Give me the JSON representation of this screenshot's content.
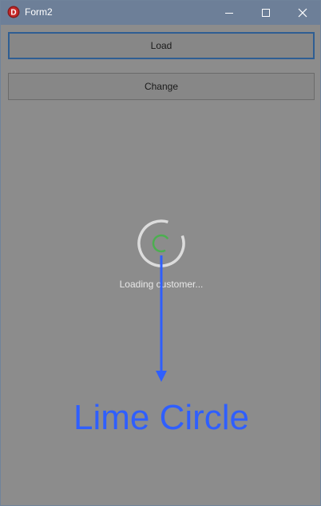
{
  "window": {
    "title": "Form2",
    "app_icon_letter": "D"
  },
  "buttons": {
    "load_label": "Load",
    "change_label": "Change"
  },
  "loading": {
    "text": "Loading customer..."
  },
  "annotation": {
    "text": "Lime Circle"
  },
  "colors": {
    "titlebar": "#6d7f98",
    "form_background": "#8c8c8c",
    "spinner_ring": "#e0e0e0",
    "spinner_inner": "#4caf50",
    "annotation_blue": "#2f5fff",
    "focus_border": "#2f5e93"
  },
  "icons": {
    "app": "app-icon",
    "minimize": "minimize-icon",
    "maximize": "maximize-icon",
    "close": "close-icon"
  }
}
